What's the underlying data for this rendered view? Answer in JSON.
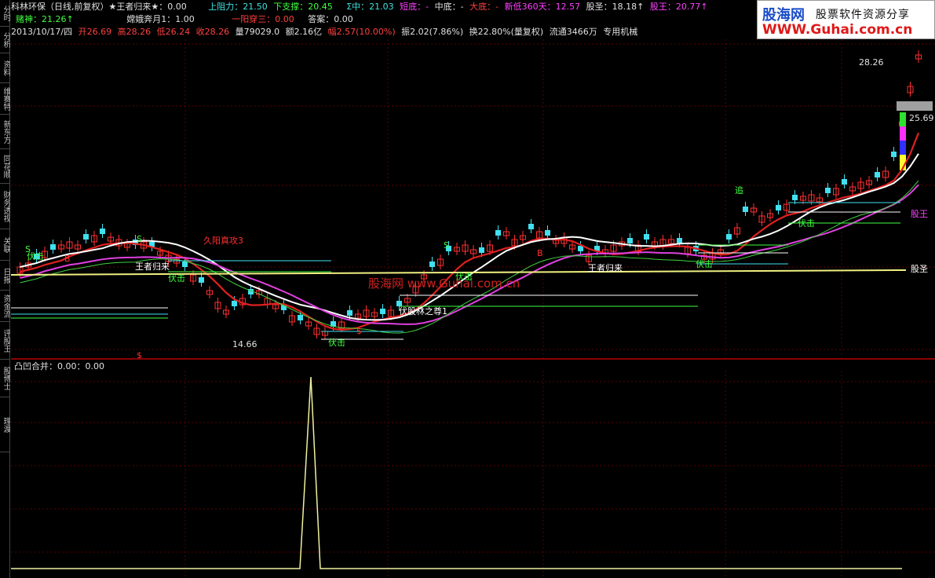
{
  "left_tabs": [
    "分时",
    "分析",
    "资料",
    "维赛特",
    "新东方",
    "同花顺",
    "财务透视",
    "关联",
    "日报",
    "资金流",
    "评股王",
    "股博士",
    "理渡"
  ],
  "header": {
    "line1": {
      "stock": "科林环保（日线,前复权）★王者归来★：0.00",
      "shangzuli": "上阻力：21.50",
      "xiazhicheng": "下支撑：20.45",
      "zhongshu": "Σ中：21.03",
      "duandi": "短底：-",
      "zhongdi": "中底：-",
      "dadi": "大底：-",
      "xindi": "新低360天：12.57",
      "gusheng": "股圣：18.18↑",
      "guwang": "股王：20.77↑"
    },
    "line2": {
      "dushen": "赌神：21.26↑",
      "chang": "嫦娥奔月1：1.00",
      "yiyang": "一阳穿三：0.00",
      "daan": "答案：0.00"
    },
    "line3": {
      "date": "2013/10/17/四",
      "open": "开26.69",
      "high": "高28.26",
      "low": "低26.24",
      "close": "收28.26",
      "vol": "量79029.0",
      "amount": "额2.16亿",
      "change": "幅2.57(10.00%)",
      "amp": "振2.02(7.86%)",
      "turnover": "换22.80%(量复权)",
      "float": "流通3466万",
      "tag": "专用机械"
    }
  },
  "logo": {
    "brand": "股海网",
    "slogan": "股票软件资源分享",
    "url": "WWW.Guhai.com.cn"
  },
  "main_chart": {
    "price_high_label": "28.26",
    "price_mid_label": "25.69",
    "price_low_label": "14.66",
    "label_guwang": "股王",
    "label_gusheng": "股圣",
    "watermark": "股海网  www.Guhai.com.cn",
    "annotations": [
      "王者归来",
      "久阳真攻3",
      "伏击",
      "伏击",
      "伏击",
      "王者归来",
      "伏击",
      "伏击",
      "伏击",
      "追",
      "伏股林之尊1",
      "S",
      "S",
      "B",
      "B",
      "S",
      "$",
      "$"
    ]
  },
  "sub_chart": {
    "title": "凸凹合并：0.00：0.00"
  },
  "colors": {
    "up_candle": "#ff3030",
    "down_candle": "#40e0f0",
    "ma_red": "#e02020",
    "ma_white": "#ffffff",
    "ma_magenta": "#e040e0",
    "ma_green": "#40d040",
    "ma_yellow": "#f0f080"
  }
}
